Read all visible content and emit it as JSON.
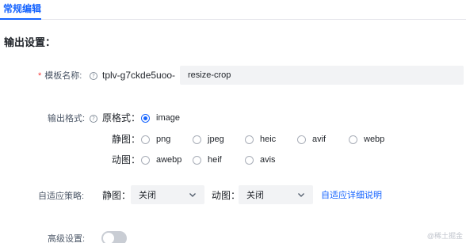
{
  "tabs": {
    "active_label": "常规编辑"
  },
  "section": {
    "title": "输出设置："
  },
  "template_name": {
    "label": "模板名称:",
    "prefix": "tplv-g7ckde5uoo-",
    "value": "resize-crop"
  },
  "output_format": {
    "label": "输出格式:",
    "original_label": "原格式：",
    "original_options": [
      {
        "label": "image",
        "checked": true
      }
    ],
    "static_label": "静图：",
    "static_options": [
      {
        "label": "png",
        "checked": false
      },
      {
        "label": "jpeg",
        "checked": false
      },
      {
        "label": "heic",
        "checked": false
      },
      {
        "label": "avif",
        "checked": false
      },
      {
        "label": "webp",
        "checked": false
      }
    ],
    "animated_label": "动图：",
    "animated_options": [
      {
        "label": "awebp",
        "checked": false
      },
      {
        "label": "heif",
        "checked": false
      },
      {
        "label": "avis",
        "checked": false
      }
    ]
  },
  "adaptive": {
    "label": "自适应策略:",
    "static_label": "静图：",
    "static_value": "关闭",
    "animated_label": "动图：",
    "animated_value": "关闭",
    "link_text": "自适应详细说明"
  },
  "advanced": {
    "label": "高级设置:",
    "enabled": false
  },
  "watermark": {
    "text": "@稀土掘金"
  },
  "colors": {
    "accent": "#1664ff",
    "required": "#f53f3f",
    "input_bg": "#f2f3f5"
  }
}
